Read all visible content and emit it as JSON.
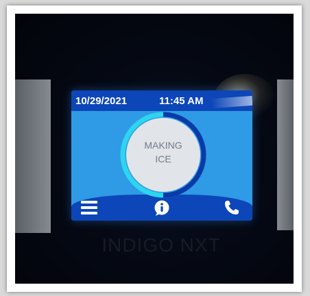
{
  "display": {
    "date": "10/29/2021",
    "time": "11:45 AM",
    "status_line1": "MAKING",
    "status_line2": "ICE"
  },
  "icons": {
    "menu": "menu-icon",
    "info": "info-icon",
    "phone": "phone-icon"
  },
  "brand": {
    "text": "INDIGO NXT"
  },
  "colors": {
    "screen_blue": "#2f9ae6",
    "bar_navy": "#0c46b8",
    "dial_face": "#e1e5ea",
    "progress_cyan": "#2dd5ee",
    "progress_dark": "#0a3aa8"
  }
}
